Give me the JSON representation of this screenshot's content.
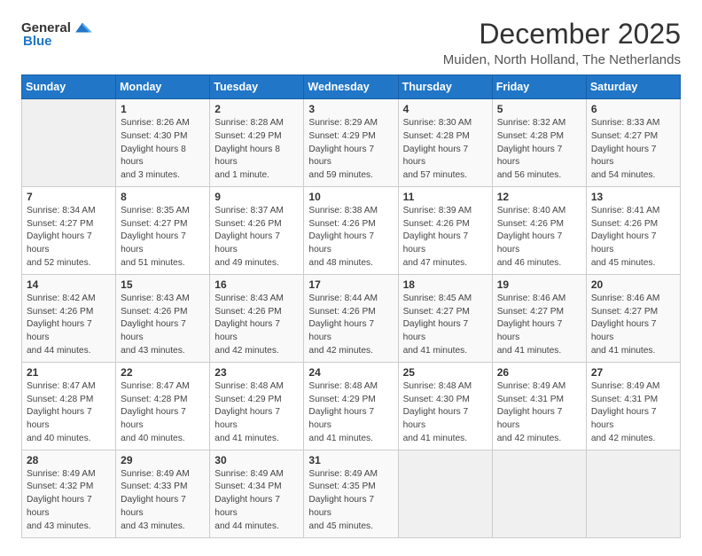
{
  "header": {
    "logo_general": "General",
    "logo_blue": "Blue",
    "month_title": "December 2025",
    "location": "Muiden, North Holland, The Netherlands"
  },
  "days_of_week": [
    "Sunday",
    "Monday",
    "Tuesday",
    "Wednesday",
    "Thursday",
    "Friday",
    "Saturday"
  ],
  "weeks": [
    [
      {
        "day": "",
        "info": ""
      },
      {
        "day": "1",
        "info": "Sunrise: 8:26 AM\nSunset: 4:30 PM\nDaylight: 8 hours\nand 3 minutes."
      },
      {
        "day": "2",
        "info": "Sunrise: 8:28 AM\nSunset: 4:29 PM\nDaylight: 8 hours\nand 1 minute."
      },
      {
        "day": "3",
        "info": "Sunrise: 8:29 AM\nSunset: 4:29 PM\nDaylight: 7 hours\nand 59 minutes."
      },
      {
        "day": "4",
        "info": "Sunrise: 8:30 AM\nSunset: 4:28 PM\nDaylight: 7 hours\nand 57 minutes."
      },
      {
        "day": "5",
        "info": "Sunrise: 8:32 AM\nSunset: 4:28 PM\nDaylight: 7 hours\nand 56 minutes."
      },
      {
        "day": "6",
        "info": "Sunrise: 8:33 AM\nSunset: 4:27 PM\nDaylight: 7 hours\nand 54 minutes."
      }
    ],
    [
      {
        "day": "7",
        "info": "Sunrise: 8:34 AM\nSunset: 4:27 PM\nDaylight: 7 hours\nand 52 minutes."
      },
      {
        "day": "8",
        "info": "Sunrise: 8:35 AM\nSunset: 4:27 PM\nDaylight: 7 hours\nand 51 minutes."
      },
      {
        "day": "9",
        "info": "Sunrise: 8:37 AM\nSunset: 4:26 PM\nDaylight: 7 hours\nand 49 minutes."
      },
      {
        "day": "10",
        "info": "Sunrise: 8:38 AM\nSunset: 4:26 PM\nDaylight: 7 hours\nand 48 minutes."
      },
      {
        "day": "11",
        "info": "Sunrise: 8:39 AM\nSunset: 4:26 PM\nDaylight: 7 hours\nand 47 minutes."
      },
      {
        "day": "12",
        "info": "Sunrise: 8:40 AM\nSunset: 4:26 PM\nDaylight: 7 hours\nand 46 minutes."
      },
      {
        "day": "13",
        "info": "Sunrise: 8:41 AM\nSunset: 4:26 PM\nDaylight: 7 hours\nand 45 minutes."
      }
    ],
    [
      {
        "day": "14",
        "info": "Sunrise: 8:42 AM\nSunset: 4:26 PM\nDaylight: 7 hours\nand 44 minutes."
      },
      {
        "day": "15",
        "info": "Sunrise: 8:43 AM\nSunset: 4:26 PM\nDaylight: 7 hours\nand 43 minutes."
      },
      {
        "day": "16",
        "info": "Sunrise: 8:43 AM\nSunset: 4:26 PM\nDaylight: 7 hours\nand 42 minutes."
      },
      {
        "day": "17",
        "info": "Sunrise: 8:44 AM\nSunset: 4:26 PM\nDaylight: 7 hours\nand 42 minutes."
      },
      {
        "day": "18",
        "info": "Sunrise: 8:45 AM\nSunset: 4:27 PM\nDaylight: 7 hours\nand 41 minutes."
      },
      {
        "day": "19",
        "info": "Sunrise: 8:46 AM\nSunset: 4:27 PM\nDaylight: 7 hours\nand 41 minutes."
      },
      {
        "day": "20",
        "info": "Sunrise: 8:46 AM\nSunset: 4:27 PM\nDaylight: 7 hours\nand 41 minutes."
      }
    ],
    [
      {
        "day": "21",
        "info": "Sunrise: 8:47 AM\nSunset: 4:28 PM\nDaylight: 7 hours\nand 40 minutes."
      },
      {
        "day": "22",
        "info": "Sunrise: 8:47 AM\nSunset: 4:28 PM\nDaylight: 7 hours\nand 40 minutes."
      },
      {
        "day": "23",
        "info": "Sunrise: 8:48 AM\nSunset: 4:29 PM\nDaylight: 7 hours\nand 41 minutes."
      },
      {
        "day": "24",
        "info": "Sunrise: 8:48 AM\nSunset: 4:29 PM\nDaylight: 7 hours\nand 41 minutes."
      },
      {
        "day": "25",
        "info": "Sunrise: 8:48 AM\nSunset: 4:30 PM\nDaylight: 7 hours\nand 41 minutes."
      },
      {
        "day": "26",
        "info": "Sunrise: 8:49 AM\nSunset: 4:31 PM\nDaylight: 7 hours\nand 42 minutes."
      },
      {
        "day": "27",
        "info": "Sunrise: 8:49 AM\nSunset: 4:31 PM\nDaylight: 7 hours\nand 42 minutes."
      }
    ],
    [
      {
        "day": "28",
        "info": "Sunrise: 8:49 AM\nSunset: 4:32 PM\nDaylight: 7 hours\nand 43 minutes."
      },
      {
        "day": "29",
        "info": "Sunrise: 8:49 AM\nSunset: 4:33 PM\nDaylight: 7 hours\nand 43 minutes."
      },
      {
        "day": "30",
        "info": "Sunrise: 8:49 AM\nSunset: 4:34 PM\nDaylight: 7 hours\nand 44 minutes."
      },
      {
        "day": "31",
        "info": "Sunrise: 8:49 AM\nSunset: 4:35 PM\nDaylight: 7 hours\nand 45 minutes."
      },
      {
        "day": "",
        "info": ""
      },
      {
        "day": "",
        "info": ""
      },
      {
        "day": "",
        "info": ""
      }
    ]
  ]
}
